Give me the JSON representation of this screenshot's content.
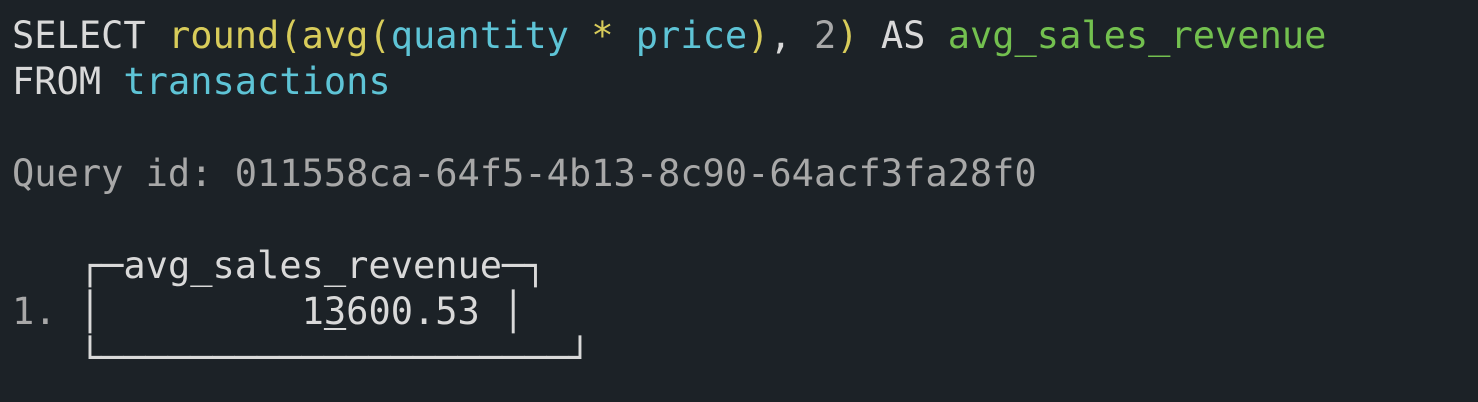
{
  "query": {
    "select_kw": "SELECT",
    "fn_round": "round",
    "paren_open_1": "(",
    "fn_avg": "avg",
    "paren_open_2": "(",
    "col_quantity": "quantity",
    "op_mul": "*",
    "col_price": "price",
    "paren_close_1": ")",
    "comma": ",",
    "precision": "2",
    "paren_close_2": ")",
    "as_kw": "AS",
    "alias": "avg_sales_revenue",
    "from_kw": "FROM",
    "table": "transactions"
  },
  "query_id": {
    "label": "Query id:",
    "value": "011558ca-64f5-4b13-8c90-64acf3fa28f0"
  },
  "result": {
    "header_left": "┌─",
    "column_name": "avg_sales_revenue",
    "header_right": "─┐",
    "row_number": "1.",
    "row_left": "│",
    "value_pad": "         ",
    "value_digit_1": "1",
    "value_digit_2_underlined": "3",
    "value_rest": "600.53",
    "row_right": "│",
    "footer": "└─────────────────────┘"
  }
}
